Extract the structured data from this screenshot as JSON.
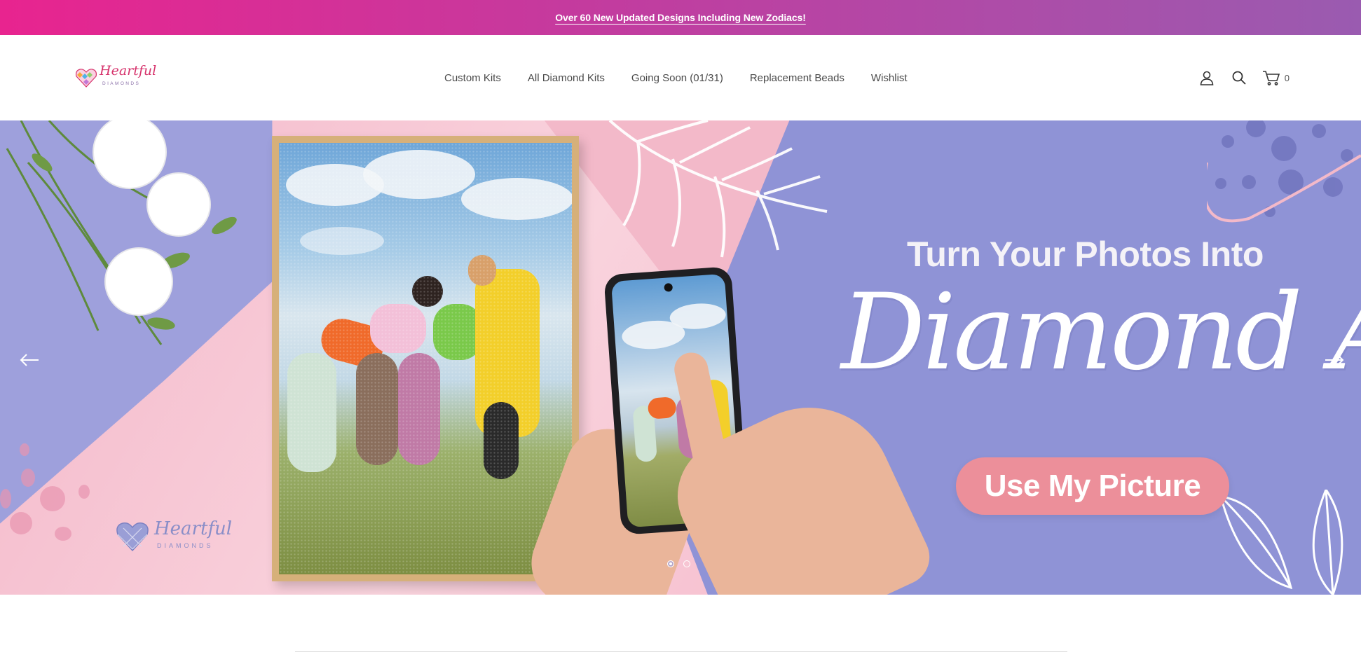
{
  "announcement": {
    "text": "Over 60 New Updated Designs Including New Zodiacs!"
  },
  "header": {
    "logo": {
      "name": "Heartful",
      "sub": "DIAMONDS"
    },
    "nav": [
      "Custom Kits",
      "All Diamond Kits",
      "Going Soon (01/31)",
      "Replacement Beads",
      "Wishlist"
    ],
    "icons": [
      "account-icon",
      "search-icon",
      "cart-icon"
    ],
    "cart_count": "0"
  },
  "hero": {
    "headline": "Turn Your Photos Into",
    "script": "Diamond Art",
    "cta": "Use My Picture",
    "brand": {
      "name": "Heartful",
      "sub": "DIAMONDS"
    },
    "slide_count": 2,
    "active_slide": 1
  },
  "colors": {
    "announce_start": "#e8248f",
    "announce_end": "#9a5bb0",
    "hero_pink": "#f6c6d4",
    "hero_purple": "#8f93d6",
    "cta": "#ec8f9a"
  }
}
